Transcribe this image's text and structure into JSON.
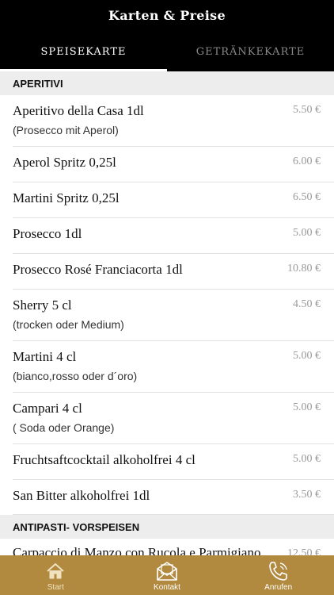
{
  "header": {
    "title": "Karten & Preise",
    "tabs": [
      {
        "label": "SPEISEKARTE",
        "active": true
      },
      {
        "label": "GETRÄNKEKARTE",
        "active": false
      }
    ]
  },
  "sections": [
    {
      "title": "APERITIVI",
      "items": [
        {
          "name": "Aperitivo della Casa 1dl",
          "desc": "(Prosecco mit Aperol)",
          "price": "5.50 €"
        },
        {
          "name": "Aperol Spritz 0,25l",
          "desc": "",
          "price": "6.00 €"
        },
        {
          "name": "Martini Spritz 0,25l",
          "desc": "",
          "price": "6.50 €"
        },
        {
          "name": "Prosecco 1dl",
          "desc": "",
          "price": "5.00 €"
        },
        {
          "name": "Prosecco Rosé Franciacorta 1dl",
          "desc": "",
          "price": "10.80 €"
        },
        {
          "name": "Sherry 5 cl",
          "desc": "(trocken oder Medium)",
          "price": "4.50 €"
        },
        {
          "name": "Martini 4 cl",
          "desc": "(bianco,rosso oder d´oro)",
          "price": "5.00 €"
        },
        {
          "name": "Campari 4 cl",
          "desc": "( Soda oder Orange)",
          "price": "5.00 €"
        },
        {
          "name": "Fruchtsaftcocktail alkoholfrei 4 cl",
          "desc": "",
          "price": "5.00 €"
        },
        {
          "name": "San Bitter alkoholfrei 1dl",
          "desc": "",
          "price": "3.50 €"
        }
      ]
    },
    {
      "title": "ANTIPASTI- VORSPEISEN",
      "items": [
        {
          "name": "Carpaccio di Manzo con Rucola e Parmigiano",
          "desc": "",
          "price": "12.50 €"
        }
      ]
    }
  ],
  "bottom_nav": [
    {
      "label": "Start",
      "icon": "home-icon",
      "active": true
    },
    {
      "label": "Kontakt",
      "icon": "mail-icon",
      "active": false
    },
    {
      "label": "Anrufen",
      "icon": "phone-icon",
      "active": false
    }
  ],
  "colors": {
    "header_bg": "#000000",
    "accent_gold": "#b18a3f",
    "section_bg": "#ededed",
    "price_gray": "#9a9a9a"
  }
}
